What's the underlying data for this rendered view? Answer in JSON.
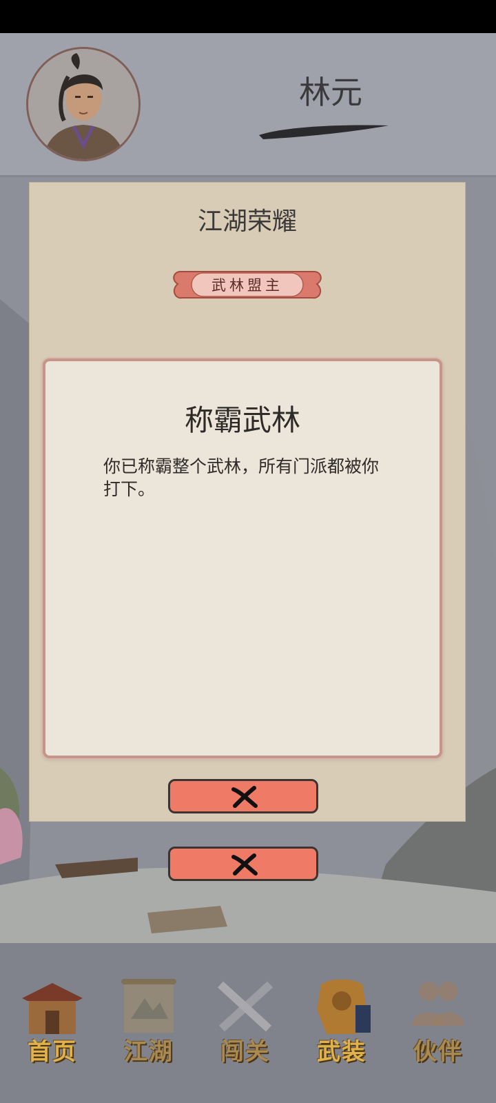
{
  "header": {
    "player_name": "林元",
    "avatar_icon": "swordsman-portrait-icon"
  },
  "glory_panel": {
    "title": "江湖荣耀",
    "badge_label": "武林盟主"
  },
  "dialog": {
    "title": "称霸武林",
    "body": "你已称霸整个武林，所有门派都被你打下。"
  },
  "buttons": {
    "close_primary_icon": "close-icon",
    "close_secondary_icon": "close-icon"
  },
  "nav": {
    "items": [
      {
        "label": "首页",
        "icon": "home-pavilion-icon"
      },
      {
        "label": "江湖",
        "icon": "scroll-map-icon"
      },
      {
        "label": "闯关",
        "icon": "crossed-blades-icon"
      },
      {
        "label": "武装",
        "icon": "armor-icon"
      },
      {
        "label": "伙伴",
        "icon": "companions-icon"
      }
    ]
  },
  "colors": {
    "accent": "#ef7a66",
    "nav_gold": "#e0b24a",
    "badge_red": "#d97a6c"
  }
}
